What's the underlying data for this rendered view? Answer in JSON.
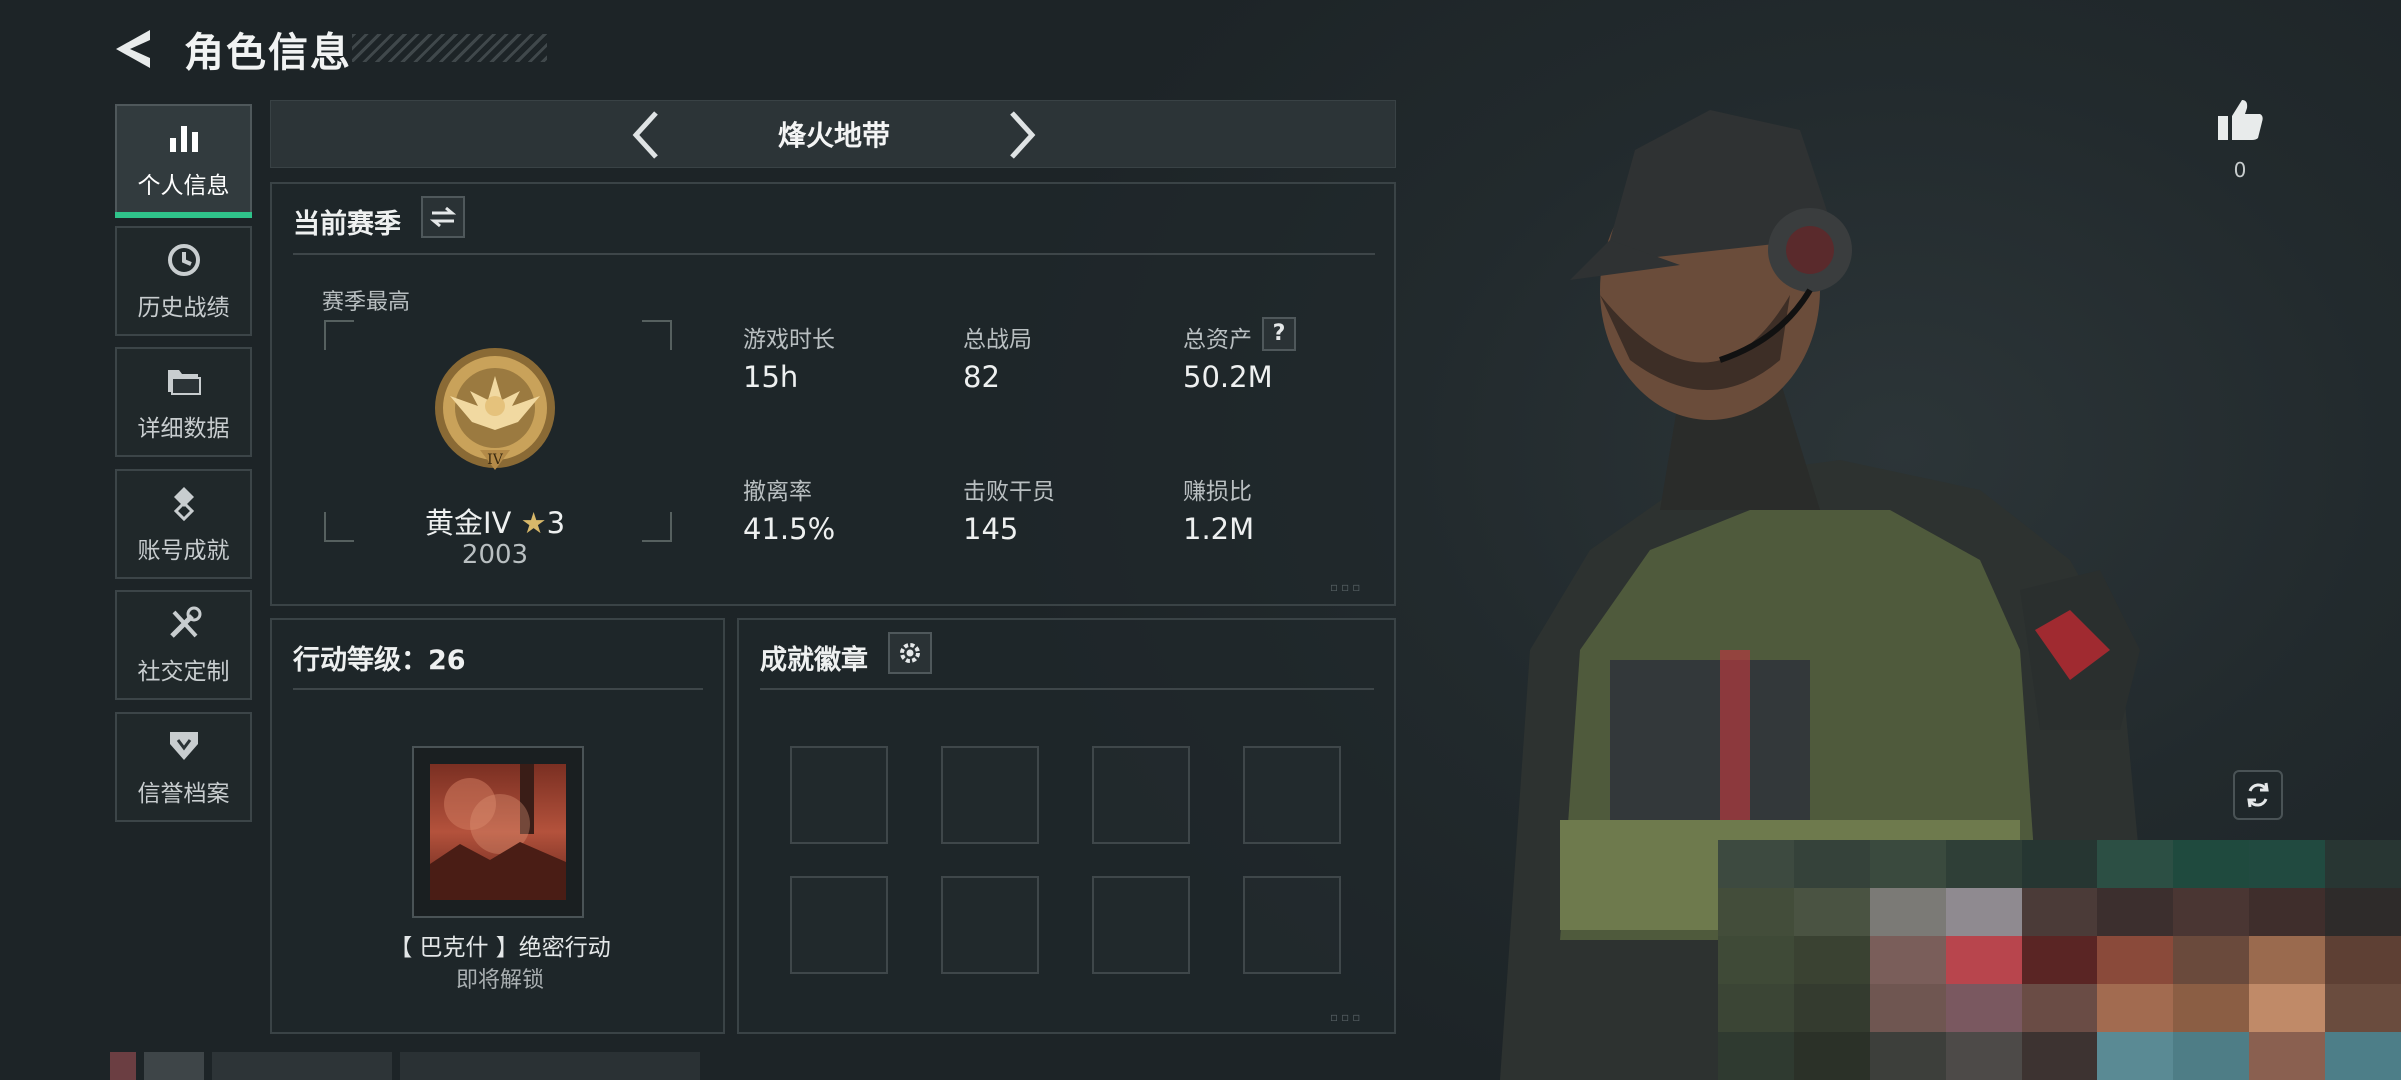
{
  "header": {
    "title": "角色信息"
  },
  "sidebar": {
    "items": [
      {
        "label": "个人信息",
        "icon": "bar-chart-icon",
        "active": true
      },
      {
        "label": "历史战绩",
        "icon": "clock-history-icon",
        "active": false
      },
      {
        "label": "详细数据",
        "icon": "folder-icon",
        "active": false
      },
      {
        "label": "账号成就",
        "icon": "achievement-medal-icon",
        "active": false
      },
      {
        "label": "社交定制",
        "icon": "wrench-tools-icon",
        "active": false
      },
      {
        "label": "信誉档案",
        "icon": "shield-credit-icon",
        "active": false
      }
    ]
  },
  "mode": {
    "title": "烽火地带"
  },
  "season": {
    "title": "当前赛季",
    "best_label": "赛季最高",
    "rank_name": "黄金IV",
    "rank_stars": "3",
    "rank_score": "2003",
    "stats": [
      {
        "label": "游戏时长",
        "value": "15h"
      },
      {
        "label": "总战局",
        "value": "82"
      },
      {
        "label": "总资产",
        "value": "50.2M",
        "has_help": true
      },
      {
        "label": "撤离率",
        "value": "41.5%"
      },
      {
        "label": "击败干员",
        "value": "145"
      },
      {
        "label": "赚损比",
        "value": "1.2M"
      }
    ],
    "help_glyph": "?"
  },
  "action_level": {
    "title": "行动等级：26",
    "card_title": "【 巴克什 】绝密行动",
    "card_status": "即将解锁"
  },
  "achievements": {
    "title": "成就徽章",
    "slot_count": 8
  },
  "like": {
    "count": "0"
  },
  "colors": {
    "accent": "#2fc38a",
    "panel_border": "#3a4346",
    "background": "#1f2629",
    "gold": "#c9a25a"
  }
}
